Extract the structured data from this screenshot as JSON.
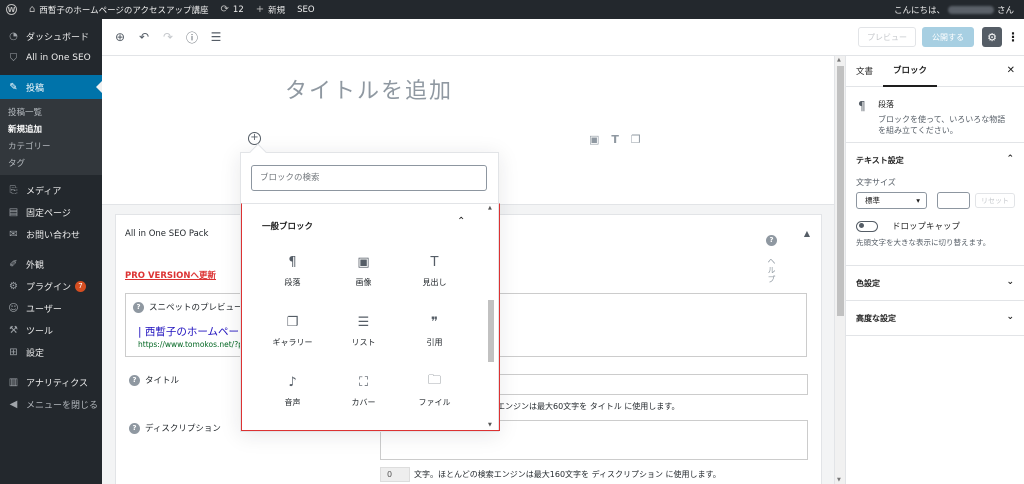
{
  "adminbar": {
    "site_name": "西暫子のホームページのアクセスアップ講座",
    "updates_count": "12",
    "new_label": "新規",
    "seo_label": "SEO",
    "greeting_prefix": "こんにちは、",
    "greeting_suffix": "さん"
  },
  "sidebar": {
    "dashboard": "ダッシュボード",
    "aioseo": "All in One SEO",
    "posts": "投稿",
    "sub_all": "投稿一覧",
    "sub_new": "新規追加",
    "sub_categories": "カテゴリー",
    "sub_tags": "タグ",
    "media": "メディア",
    "pages": "固定ページ",
    "contact": "お問い合わせ",
    "appearance": "外観",
    "plugins": "プラグイン",
    "plugins_badge": "7",
    "users": "ユーザー",
    "tools": "ツール",
    "settings": "設定",
    "analytics": "アナリティクス",
    "collapse": "メニューを閉じる"
  },
  "toolbar": {
    "preview": "プレビュー",
    "publish": "公開する"
  },
  "editor": {
    "title_placeholder": "タイトルを追加"
  },
  "inserter": {
    "search_placeholder": "ブロックの検索",
    "panel_title": "一般ブロック",
    "blocks": [
      {
        "icon": "paragraph-icon",
        "glyph": "¶",
        "label": "段落"
      },
      {
        "icon": "image-icon",
        "glyph": "▣",
        "label": "画像"
      },
      {
        "icon": "heading-icon",
        "glyph": "T",
        "label": "見出し"
      },
      {
        "icon": "gallery-icon",
        "glyph": "❐",
        "label": "ギャラリー"
      },
      {
        "icon": "list-icon",
        "glyph": "☰",
        "label": "リスト"
      },
      {
        "icon": "quote-icon",
        "glyph": "❞",
        "label": "引用"
      },
      {
        "icon": "audio-icon",
        "glyph": "♪",
        "label": "音声"
      },
      {
        "icon": "cover-icon",
        "glyph": "⛶",
        "label": "カバー"
      },
      {
        "icon": "file-icon",
        "glyph": "🗀",
        "label": "ファイル"
      }
    ]
  },
  "aioseo": {
    "title": "All in One SEO Pack",
    "help_vertical": "ヘルプ",
    "pro_link": "PRO VERSIONへ更新",
    "snippet_label": "スニペットのプレビュー",
    "snippet_title": "| 西暫子のホームペー",
    "snippet_url": "https://www.tomokos.net/?p",
    "title_label": "タイトル",
    "title_note": "エンジンは最大60文字を タイトル に使用します。",
    "desc_label": "ディスクリプション",
    "desc_count": "0",
    "desc_note": "文字。ほとんどの検索エンジンは最大160文字を ディスクリプション に使用します。"
  },
  "settings_sidebar": {
    "tab_document": "文書",
    "tab_block": "ブロック",
    "block_name": "段落",
    "block_desc": "ブロックを使って、いろいろな物語を組み立てください。",
    "text_settings": "テキスト設定",
    "font_size_label": "文字サイズ",
    "font_size_value": "標準",
    "reset": "リセット",
    "drop_cap": "ドロップキャップ",
    "drop_cap_help": "先頭文字を大きな表示に切り替えます。",
    "color_settings": "色設定",
    "advanced": "高度な設定"
  }
}
